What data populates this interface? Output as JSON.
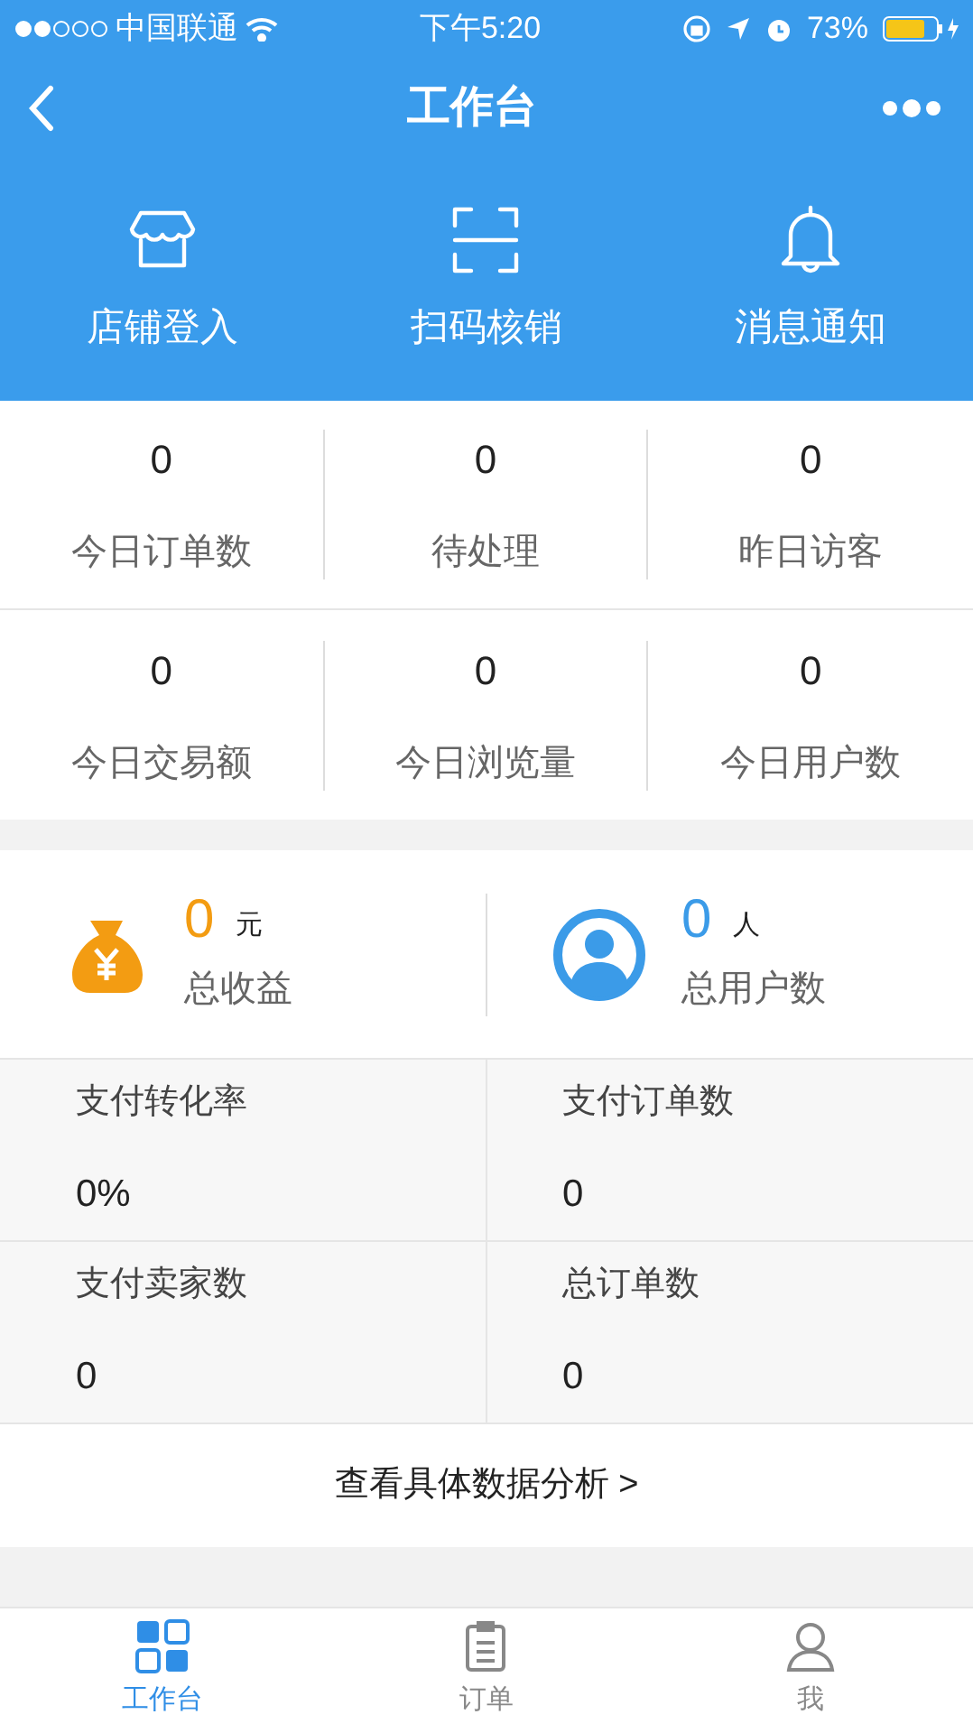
{
  "status_bar": {
    "carrier": "中国联通",
    "time": "下午5:20",
    "battery": "73%"
  },
  "nav": {
    "title": "工作台"
  },
  "shortcuts": [
    {
      "kind": "store",
      "label": "店铺登入"
    },
    {
      "kind": "scan",
      "label": "扫码核销"
    },
    {
      "kind": "bell",
      "label": "消息通知"
    }
  ],
  "stats": [
    {
      "value": "0",
      "label": "今日订单数"
    },
    {
      "value": "0",
      "label": "待处理"
    },
    {
      "value": "0",
      "label": "昨日访客"
    },
    {
      "value": "0",
      "label": "今日交易额"
    },
    {
      "value": "0",
      "label": "今日浏览量"
    },
    {
      "value": "0",
      "label": "今日用户数"
    }
  ],
  "summary": [
    {
      "kind": "money",
      "value": "0",
      "unit": "元",
      "label": "总收益"
    },
    {
      "kind": "user",
      "value": "0",
      "unit": "人",
      "label": "总用户数"
    }
  ],
  "metrics": [
    {
      "label": "支付转化率",
      "value": "0%"
    },
    {
      "label": "支付订单数",
      "value": "0"
    },
    {
      "label": "支付卖家数",
      "value": "0"
    },
    {
      "label": "总订单数",
      "value": "0"
    }
  ],
  "analysis_link": "查看具体数据分析 >",
  "tabs": [
    {
      "kind": "dashboard",
      "label": "工作台",
      "selected": true
    },
    {
      "kind": "orders",
      "label": "订单",
      "selected": false
    },
    {
      "kind": "me",
      "label": "我",
      "selected": false
    }
  ]
}
